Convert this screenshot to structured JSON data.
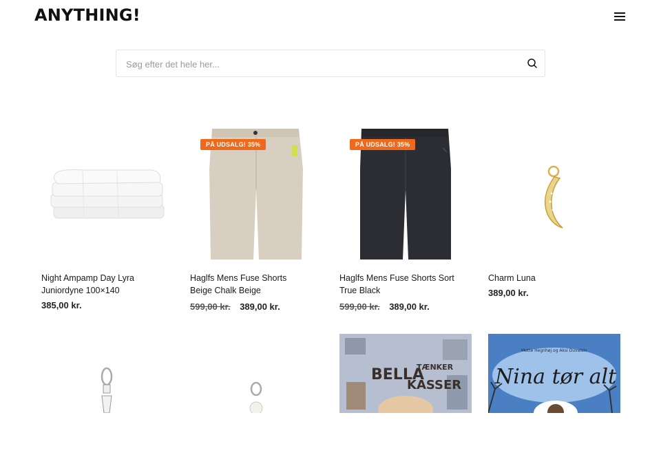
{
  "header": {
    "logo": "ANYTHING!"
  },
  "search": {
    "placeholder": "Søg efter det hele her..."
  },
  "products": [
    {
      "name": "Night Ampamp Day Lyra Juniordyne 100×140",
      "price": "385,00 kr."
    },
    {
      "name": "Haglfs Mens Fuse Shorts Beige Chalk Beige",
      "old_price": "599,00 kr.",
      "price": "389,00 kr.",
      "badge": "PÅ UDSALG! 35%"
    },
    {
      "name": "Haglfs Mens Fuse Shorts Sort True Black",
      "old_price": "599,00 kr.",
      "price": "389,00 kr.",
      "badge": "PÅ UDSALG! 35%"
    },
    {
      "name": "Charm Luna",
      "price": "389,00 kr."
    }
  ],
  "books": [
    {
      "title_line1": "BELLA",
      "title_small": "TÆNKER",
      "title_line2": "KASSER"
    },
    {
      "author": "Mette Hegnhøj og Aksi Duvalsin",
      "title": "Nina tør alt"
    }
  ],
  "icons": {
    "menu": "hamburger-menu-icon",
    "search": "search-icon"
  },
  "colors": {
    "badge": "#ee6a1a"
  }
}
